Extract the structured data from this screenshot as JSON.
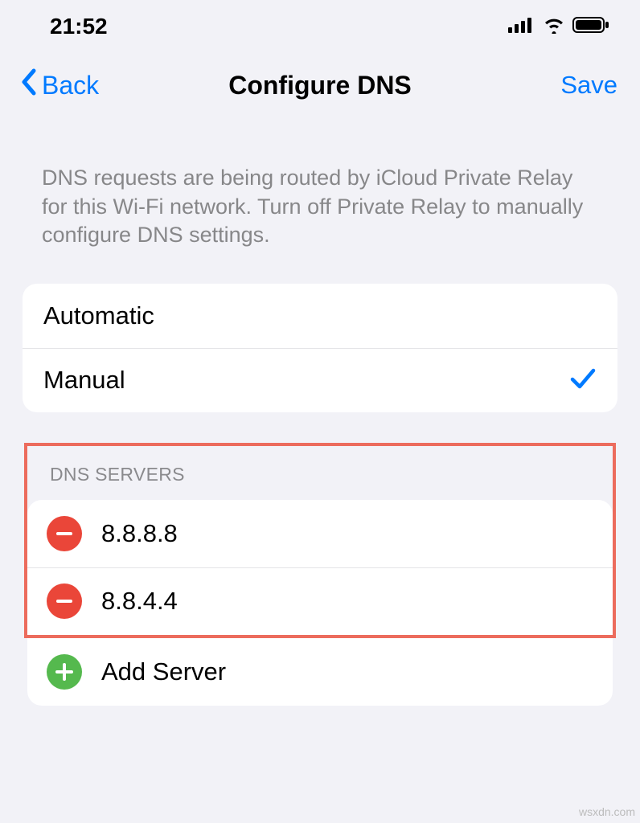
{
  "statusBar": {
    "time": "21:52"
  },
  "nav": {
    "back": "Back",
    "title": "Configure DNS",
    "save": "Save"
  },
  "description": "DNS requests are being routed by iCloud Private Relay for this Wi-Fi network. Turn off Private Relay to manually configure DNS settings.",
  "modes": {
    "automatic": "Automatic",
    "manual": "Manual",
    "selected": "manual"
  },
  "dnsSection": {
    "header": "DNS SERVERS",
    "servers": [
      "8.8.8.8",
      "8.8.4.4"
    ],
    "addLabel": "Add Server"
  },
  "watermark": "wsxdn.com"
}
